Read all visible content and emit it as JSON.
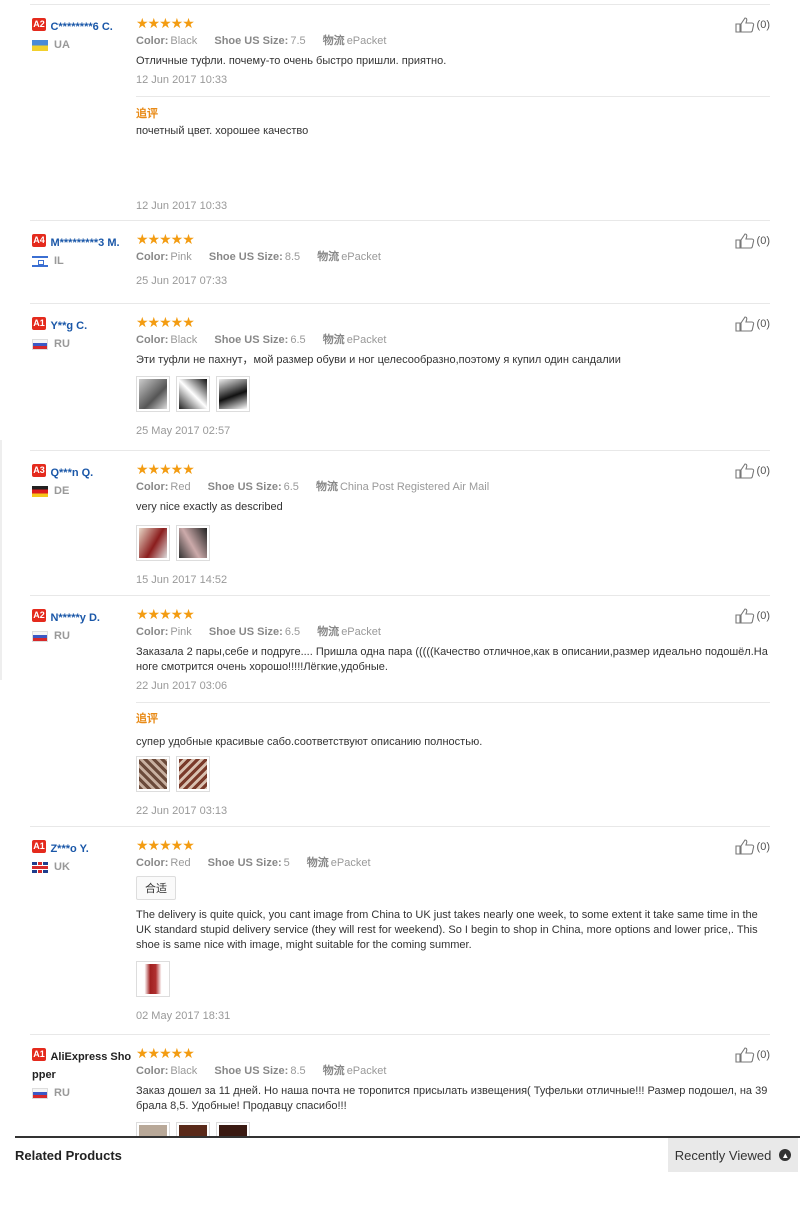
{
  "reviews": [
    {
      "level": "A2",
      "name": "C********6 C.",
      "country": "UA",
      "stars": "★★★★★",
      "color_label": "Color:",
      "color": "Black",
      "size_label": "Shoe US Size:",
      "size": "7.5",
      "ship_label": "物流",
      "ship": "ePacket",
      "text": "Отличные туфли. почему-то очень быстро пришли. приятно.",
      "date": "12 Jun 2017 10:33",
      "followup_label": "追评",
      "followup_text": "почетный цвет. хорошее качество",
      "followup_date": "12 Jun 2017 10:33",
      "helpful": "(0)"
    },
    {
      "level": "A4",
      "name": "M*********3 M.",
      "country": "IL",
      "stars": "★★★★★",
      "color_label": "Color:",
      "color": "Pink",
      "size_label": "Shoe US Size:",
      "size": "8.5",
      "ship_label": "物流",
      "ship": "ePacket",
      "date": "25 Jun 2017 07:33",
      "helpful": "(0)"
    },
    {
      "level": "A1",
      "name": "Y**g C.",
      "country": "RU",
      "stars": "★★★★★",
      "color_label": "Color:",
      "color": "Black",
      "size_label": "Shoe US Size:",
      "size": "6.5",
      "ship_label": "物流",
      "ship": "ePacket",
      "text": "Эти туфли не пахнут，мой размер обуви и ног целесообразно,поэтому я купил один сандалии",
      "date": "25 May 2017 02:57",
      "helpful": "(0)"
    },
    {
      "level": "A3",
      "name": "Q***n Q.",
      "country": "DE",
      "stars": "★★★★★",
      "color_label": "Color:",
      "color": "Red",
      "size_label": "Shoe US Size:",
      "size": "6.5",
      "ship_label": "物流",
      "ship": "China Post Registered Air Mail",
      "text": "very nice exactly as described",
      "date": "15 Jun 2017 14:52",
      "helpful": "(0)"
    },
    {
      "level": "A2",
      "name": "N*****y D.",
      "country": "RU",
      "stars": "★★★★★",
      "color_label": "Color:",
      "color": "Pink",
      "size_label": "Shoe US Size:",
      "size": "6.5",
      "ship_label": "物流",
      "ship": "ePacket",
      "text": "Заказала 2 пары,себе и подруге.... Пришла одна пара (((((Качество отличное,как в описании,размер идеально подошёл.На ноге смотрится очень хорошо!!!!!Лёгкие,удобные.",
      "date": "22 Jun 2017 03:06",
      "followup_label": "追评",
      "followup_text": "супер удобные красивые сабо.соответствуют описанию полностью.",
      "followup_date": "22 Jun 2017 03:13",
      "helpful": "(0)"
    },
    {
      "level": "A1",
      "name": "Z***o Y.",
      "country": "UK",
      "stars": "★★★★★",
      "color_label": "Color:",
      "color": "Red",
      "size_label": "Shoe US Size:",
      "size": "5",
      "ship_label": "物流",
      "ship": "ePacket",
      "tag": "合适",
      "text": "The delivery is quite quick, you cant image from China to UK just takes nearly one week, to some extent it take same time in the UK standard stupid delivery service (they will rest for weekend). So I begin to shop in China, more options and lower price,. This shoe is same nice with image, might suitable for the coming summer.",
      "date": "02 May 2017 18:31",
      "helpful": "(0)"
    },
    {
      "level": "A1",
      "name": "AliExpress Shopper",
      "country": "RU",
      "stars": "★★★★★",
      "color_label": "Color:",
      "color": "Black",
      "size_label": "Shoe US Size:",
      "size": "8.5",
      "ship_label": "物流",
      "ship": "ePacket",
      "text": "Заказ дошел за 11 дней. Но наша почта не торопится присылать извещения( Туфельки отличные!!! Размер подошел, на 39 брала 8,5. Удобные! Продавцу спасибо!!!",
      "helpful": "(0)"
    }
  ],
  "footer": {
    "related": "Related Products",
    "recently_viewed": "Recently Viewed"
  },
  "colors": {
    "accent_blue": "#1a57a8",
    "star": "#f39c12",
    "level_badge": "#e42a1d",
    "followup": "#e88a16"
  }
}
